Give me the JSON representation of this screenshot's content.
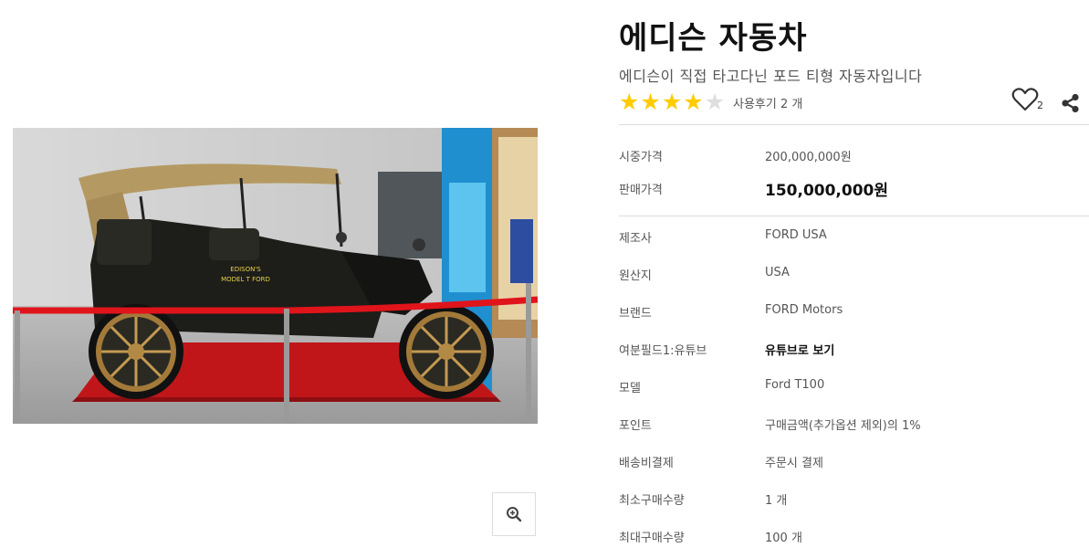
{
  "product": {
    "title": "에디슨 자동차",
    "subtitle": "에디슨이 직접 타고다닌 포드 티형 자동자입니다",
    "rating": 4,
    "rating_max": 5,
    "review_label": "사용후기 2 개",
    "wishlist_count": "2"
  },
  "prices": [
    {
      "label": "시중가격",
      "value": "200,000,000원"
    },
    {
      "label": "판매가격",
      "value": "150,000,000원"
    }
  ],
  "specs": [
    {
      "label": "제조사",
      "value": "FORD USA"
    },
    {
      "label": "원산지",
      "value": "USA"
    },
    {
      "label": "브랜드",
      "value": "FORD Motors"
    },
    {
      "label": "여분필드1:유튜브",
      "value": "유튜브로 보기"
    },
    {
      "label": "모델",
      "value": "Ford T100"
    },
    {
      "label": "포인트",
      "value": "구매금액(추가옵션 제외)의 1%"
    },
    {
      "label": "배송비결제",
      "value": "주문시 결제"
    },
    {
      "label": "최소구매수량",
      "value": "1 개"
    },
    {
      "label": "최대구매수량",
      "value": "100 개"
    }
  ],
  "image": {
    "car_badge_line1": "EDISON'S",
    "car_badge_line2": "MODEL T FORD"
  },
  "colors": {
    "star_on": "#ffcc00",
    "star_off": "#dedede",
    "divider": "#dcdcdc",
    "title": "#111111"
  },
  "icons": {
    "zoom": "magnifier-plus-icon",
    "wishlist": "heart-outline-icon",
    "share": "share-nodes-icon"
  }
}
